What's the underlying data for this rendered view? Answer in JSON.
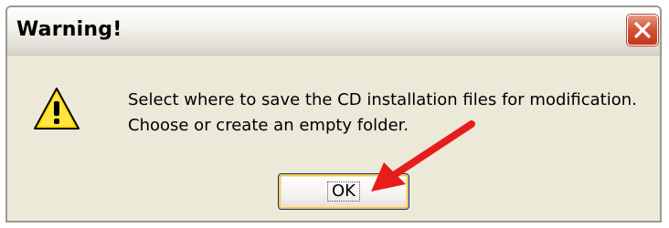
{
  "dialog": {
    "title": "Warning!",
    "message_lines": [
      "Select where to save the CD installation files for modification.",
      "Choose or create an empty folder."
    ],
    "ok_label": "OK",
    "icon": "warning-icon",
    "close_icon": "close-icon"
  },
  "colors": {
    "dialog_bg": "#ece9d8",
    "close_button": "#d5553a",
    "warning_yellow": "#ffd800",
    "annotation_arrow": "#e81c1c"
  }
}
